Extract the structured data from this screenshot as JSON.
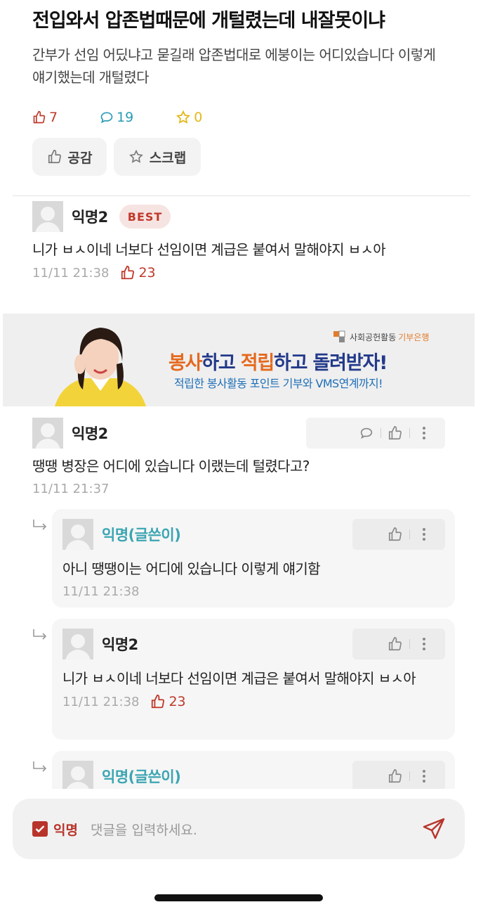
{
  "post": {
    "title": "전입와서 압존법때문에 개털렸는데 내잘못이냐",
    "body": "간부가 선임 어딨냐고 묻길래 압존법대로 에붕이는 어디있습니다 이렇게 얘기했는데 개털렸다",
    "likes": "7",
    "comments": "19",
    "scraps": "0",
    "like_button": "공감",
    "scrap_button": "스크랩"
  },
  "best_comment": {
    "author": "익명2",
    "badge": "BEST",
    "text": "니가 ㅂㅅ이네 너보다 선임이면 계급은 붙여서 말해야지 ㅂㅅ아",
    "time": "11/11 21:38",
    "likes": "23"
  },
  "ad": {
    "org": "사회공헌활동",
    "org_accent": "기부은행",
    "headline_1": "봉사",
    "headline_2": "하고 ",
    "headline_3": "적립",
    "headline_4": "하고 돌려받자!",
    "sub": "적립한 봉사활동 포인트 기부와 VMS연계까지!"
  },
  "comment_2": {
    "author": "익명2",
    "text": "땡땡 병장은 어디에 있습니다 이랬는데 털렸다고?",
    "time": "11/11 21:37"
  },
  "replies": [
    {
      "author": "익명(글쓴이)",
      "text": "아니 땡땡이는 어디에 있습니다 이렇게 얘기함",
      "time": "11/11 21:38",
      "likes": ""
    },
    {
      "author": "익명2",
      "text": "니가 ㅂㅅ이네 너보다 선임이면 계급은 붙여서 말해야지 ㅂㅅ아",
      "time": "11/11 21:38",
      "likes": "23"
    },
    {
      "author": "익명(글쓴이)",
      "text": "",
      "time": "",
      "likes": ""
    }
  ],
  "input": {
    "anon_label": "익명",
    "placeholder": "댓글을 입력하세요."
  },
  "colors": {
    "accent_red": "#c0392b",
    "writer_teal": "#3ba5b2",
    "comment_blue": "#2a9bb5",
    "scrap_yellow": "#e4b91a"
  }
}
